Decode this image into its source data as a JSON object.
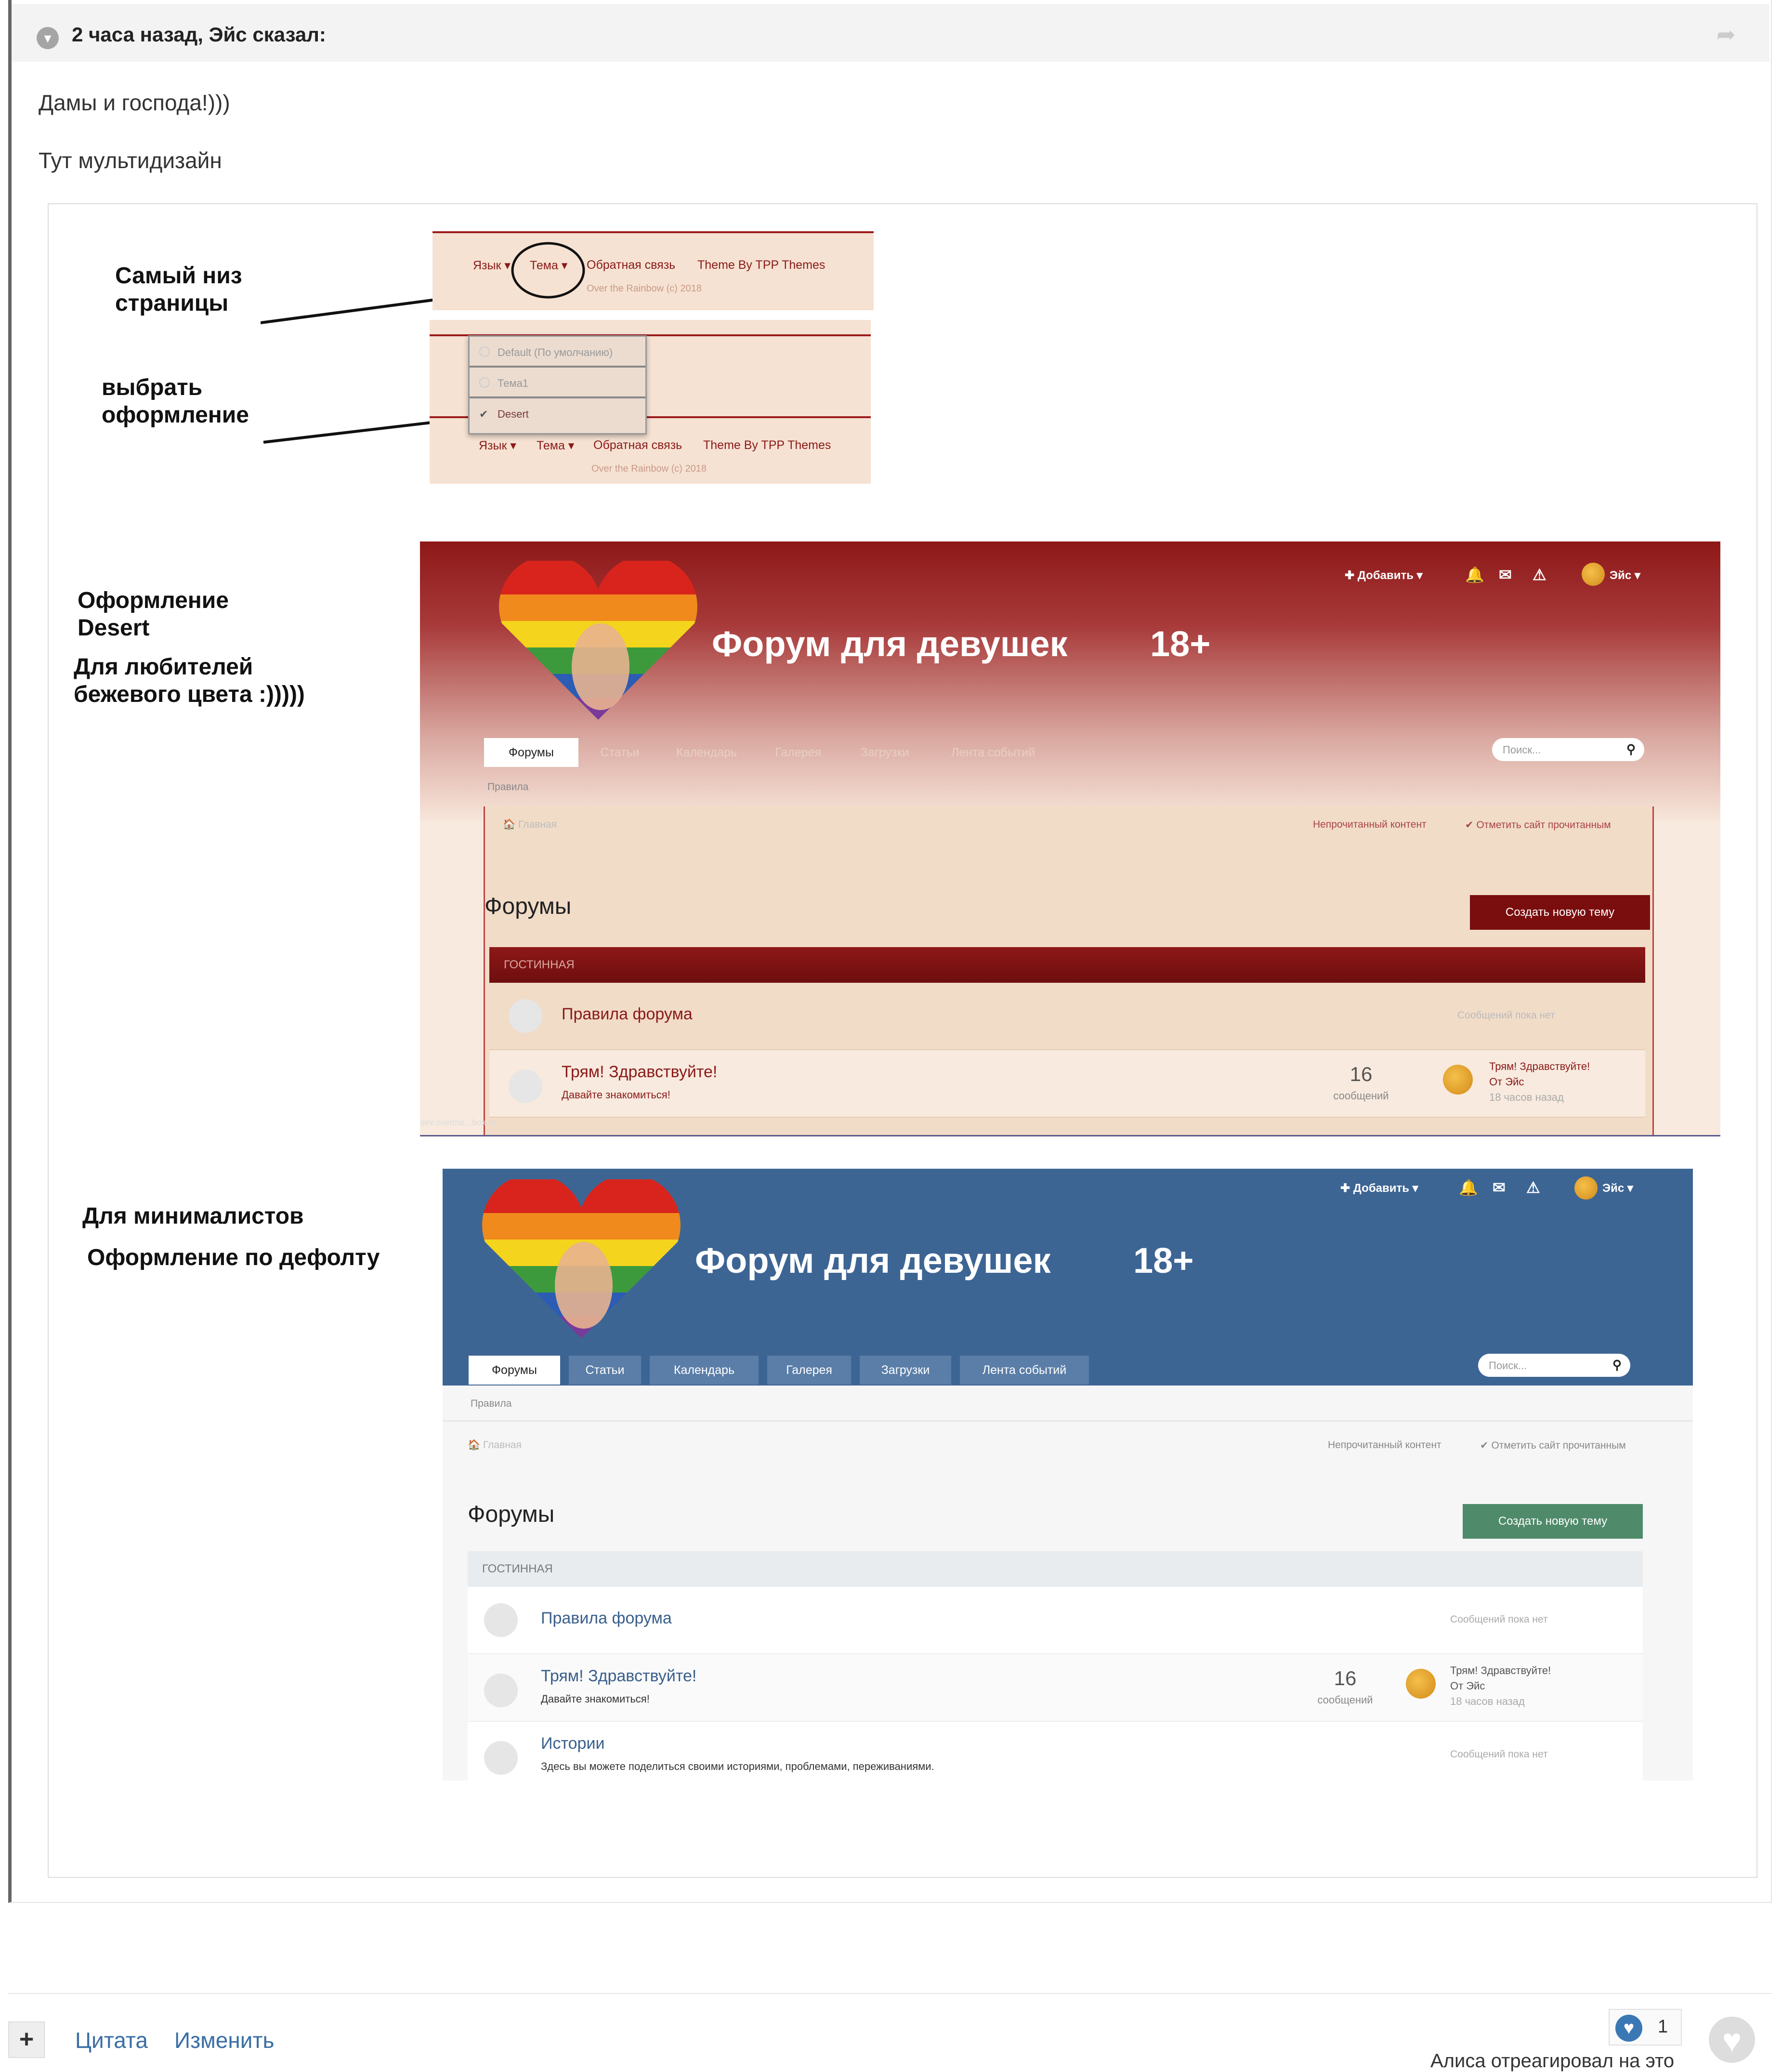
{
  "quote": {
    "citation": "2 часа назад, Эйс сказал:",
    "paragraphs": [
      "Дамы и господа!)))",
      "Тут мультидизайн"
    ]
  },
  "notes": {
    "bottom_of_page": "Самый низ\nстраницы",
    "choose_theme": "выбрать\nоформление",
    "desert_title": "Оформление\nDesert",
    "desert_sub": "Для любителей\nбежевого цвета :)))))",
    "minimal_title": "Для минималистов",
    "minimal_sub": "Оформление по дефолту"
  },
  "footer_strip": {
    "lang": "Язык ▾",
    "theme": "Тема ▾",
    "feedback": "Обратная связь",
    "theme_by": "Theme By TPP Themes",
    "copyright": "Over the Rainbow (c) 2018",
    "dropdown": [
      "Default (По умолчанию)",
      "Тема1",
      "Desert"
    ],
    "selected": "Desert"
  },
  "forum": {
    "add": "✚ Добавить ▾",
    "user": "Эйс ▾",
    "site_title": "Форум для девушек",
    "age": "18+",
    "tabs": [
      "Форумы",
      "Статьи",
      "Календарь",
      "Галерея",
      "Загрузки",
      "Лента событий"
    ],
    "search_placeholder": "Поиск...",
    "rules_link": "Правила",
    "home": "🏠 Главная",
    "unread": "Непрочитанный контент",
    "mark_read": "✔ Отметить сайт прочитанным",
    "page_title": "Форумы",
    "new_topic": "Создать новую тему",
    "category": "ГОСТИННАЯ",
    "forums": [
      {
        "name": "Правила форума",
        "desc": "",
        "last": "Сообщений пока нет"
      },
      {
        "name": "Трям! Здравствуйте!",
        "desc": "Давайте знакомиться!",
        "count": "16",
        "count_label": "сообщений",
        "last_title": "Трям! Здравствуйте!",
        "last_by": "От Эйс",
        "last_time": "18 часов назад"
      },
      {
        "name": "Истории",
        "desc": "Здесь вы можете поделиться своими историями, проблемами, переживаниями.",
        "last": "Сообщений пока нет"
      }
    ],
    "url_hint": "dev.overthe...box.ru"
  },
  "post_actions": {
    "plus": "+",
    "quote": "Цитата",
    "edit": "Изменить",
    "reaction_count": "1",
    "reaction_text": "Алиса отреагировал на это"
  },
  "colors": {
    "desert_header": "#8e1818",
    "desert_button": "#7a0e0e",
    "default_header": "#3d6594",
    "default_button": "#4f8a6a",
    "link_blue": "#3a6ea5"
  }
}
